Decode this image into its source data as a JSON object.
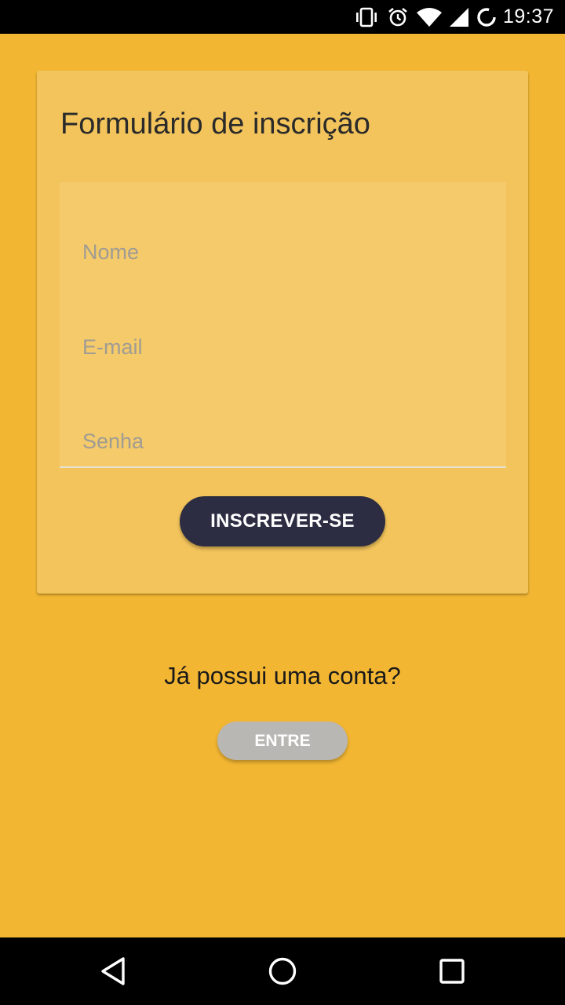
{
  "status_bar": {
    "time": "19:37",
    "icons": [
      "vibrate-icon",
      "alarm-icon",
      "wifi-icon",
      "signal-icon",
      "sync-icon"
    ]
  },
  "form": {
    "title": "Formulário de inscrição",
    "fields": {
      "name_placeholder": "Nome",
      "email_placeholder": "E-mail",
      "password_placeholder": "Senha"
    },
    "submit_label": "INSCREVER-SE"
  },
  "login": {
    "question": "Já possui uma conta?",
    "button_label": "ENTRE"
  },
  "nav_bar": {
    "icons": [
      "back-icon",
      "home-icon",
      "recents-icon"
    ]
  },
  "colors": {
    "background": "#F2B632",
    "card": "#F3C45C",
    "form_panel": "#F4CA6B",
    "primary_button": "#2C2D42",
    "secondary_button": "#B9B7B3"
  }
}
